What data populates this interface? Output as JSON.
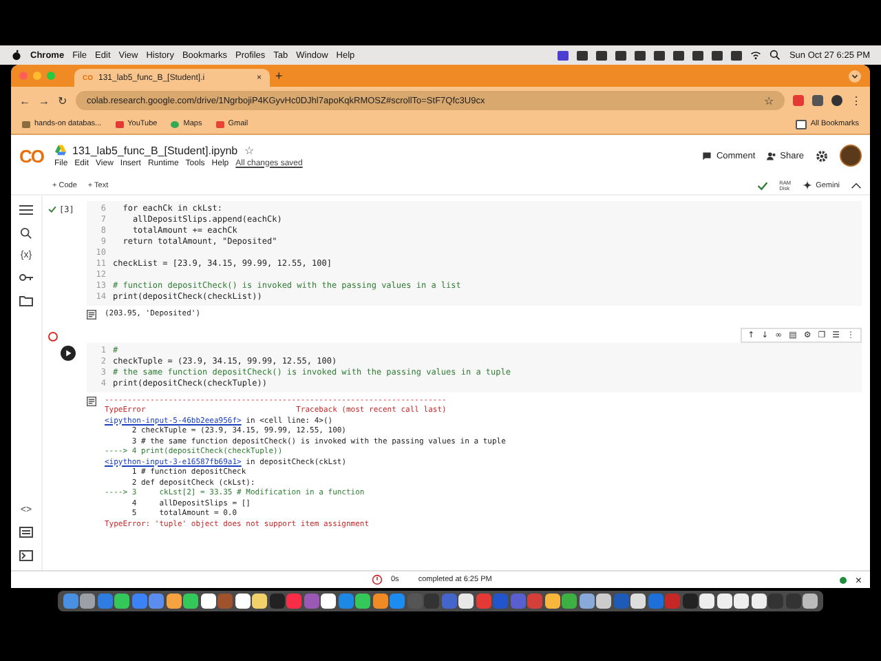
{
  "menubar": {
    "app": "Chrome",
    "menus": [
      "File",
      "Edit",
      "View",
      "History",
      "Bookmarks",
      "Profiles",
      "Tab",
      "Window",
      "Help"
    ],
    "clock": "Sun Oct 27  6:25 PM"
  },
  "browser": {
    "tab_icon": "CO",
    "tab_title": "131_lab5_func_B_[Student].i",
    "tab_close": "×",
    "new_tab": "+",
    "nav": [
      "←",
      "→",
      "↻"
    ],
    "url": "colab.research.google.com/drive/1NgrbojiP4KGyvHc0DJhl7apoKqkRMOSZ#scrollTo=StF7Qfc3U9cx",
    "bookmark_star": "☆",
    "more": "⋮",
    "bookmarks": [
      {
        "kind": "folder",
        "label": "hands-on databas..."
      },
      {
        "kind": "video",
        "label": "YouTube"
      },
      {
        "kind": "pin",
        "label": "Maps"
      },
      {
        "kind": "mail",
        "label": "Gmail"
      }
    ],
    "all_bookmarks": "All Bookmarks"
  },
  "notebook": {
    "logo": "CO",
    "title": "131_lab5_func_B_[Student].ipynb",
    "star": "☆",
    "menus": [
      "File",
      "Edit",
      "View",
      "Insert",
      "Runtime",
      "Tools",
      "Help"
    ],
    "save_status": "All changes saved",
    "comment": "Comment",
    "share": "Share"
  },
  "toolbar": {
    "add_code": "+ Code",
    "add_text": "+ Text",
    "ram": "RAM",
    "disk": "Disk",
    "gemini": "Gemini"
  },
  "sidebar": {
    "variables": "{x}",
    "snippets": "<>"
  },
  "cells": [
    {
      "error": false,
      "exec_count": "[3]",
      "lines": [
        {
          "n": "6",
          "kind": "code",
          "text": "  for eachCk in ckLst:"
        },
        {
          "n": "7",
          "kind": "code",
          "text": "    allDepositSlips.append(eachCk)"
        },
        {
          "n": "8",
          "kind": "code",
          "text": "    totalAmount += eachCk"
        },
        {
          "n": "9",
          "kind": "code",
          "text": "  return totalAmount, \"Deposited\""
        },
        {
          "n": "10",
          "kind": "code"
        },
        {
          "n": "11",
          "kind": "code",
          "text": "checkList = [23.9, 34.15, 99.99, 12.55, 100]"
        },
        {
          "n": "12",
          "kind": "code"
        },
        {
          "n": "13",
          "kind": "comment",
          "text": "# function depositCheck() is invoked with the passing values in a list"
        },
        {
          "n": "14",
          "kind": "code",
          "text": "print(depositCheck(checkList))"
        }
      ],
      "output": [
        {
          "kind": "plain",
          "text": "(203.95, 'Deposited')"
        }
      ]
    },
    {
      "error": true,
      "cell_toolbar": [
        "↑",
        "↓",
        "∞",
        "▤",
        "⚙",
        "❐",
        "☰",
        "⋮"
      ],
      "lines": [
        {
          "n": "1",
          "kind": "comment",
          "text": "#"
        },
        {
          "n": "2",
          "kind": "code",
          "text": "checkTuple = (23.9, 34.15, 99.99, 12.55, 100)"
        },
        {
          "n": "3",
          "kind": "comment",
          "text": "# the same function depositCheck() is invoked with the passing values in a tuple"
        },
        {
          "n": "4",
          "kind": "code",
          "text": "print(depositCheck(checkTuple))"
        }
      ],
      "output": [
        {
          "kind": "rule",
          "text": "---------------------------------------------------------------------------"
        },
        {
          "kind": "error",
          "text": "TypeError                                 Traceback (most recent call last)"
        },
        {
          "kind": "link",
          "link": "<ipython-input-5-46bb2eea956f>",
          "text": " in <cell line: 4>()"
        },
        {
          "kind": "plain",
          "text": "      2 checkTuple = (23.9, 34.15, 99.99, 12.55, 100)"
        },
        {
          "kind": "plain",
          "text": "      3 # the same function depositCheck() is invoked with the passing values in a tuple"
        },
        {
          "kind": "arrow",
          "text": "----> 4 print(depositCheck(checkTuple))"
        },
        {
          "kind": "link",
          "link": "<ipython-input-3-e16587fb69a1>",
          "text": " in depositCheck(ckLst)"
        },
        {
          "kind": "plain",
          "text": "      1 # function depositCheck"
        },
        {
          "kind": "plain",
          "text": "      2 def depositCheck (ckLst):"
        },
        {
          "kind": "arrow",
          "text": "----> 3     ckLst[2] = 33.35 # Modification in a function"
        },
        {
          "kind": "plain",
          "text": "      4     allDepositSlips = []"
        },
        {
          "kind": "plain",
          "text": "      5     totalAmount = 0.0"
        },
        {
          "kind": "error",
          "text": "TypeError: 'tuple' object does not support item assignment"
        }
      ]
    }
  ],
  "status_bar": {
    "duration": "0s",
    "message": "completed at 6:25 PM",
    "close": "×"
  }
}
